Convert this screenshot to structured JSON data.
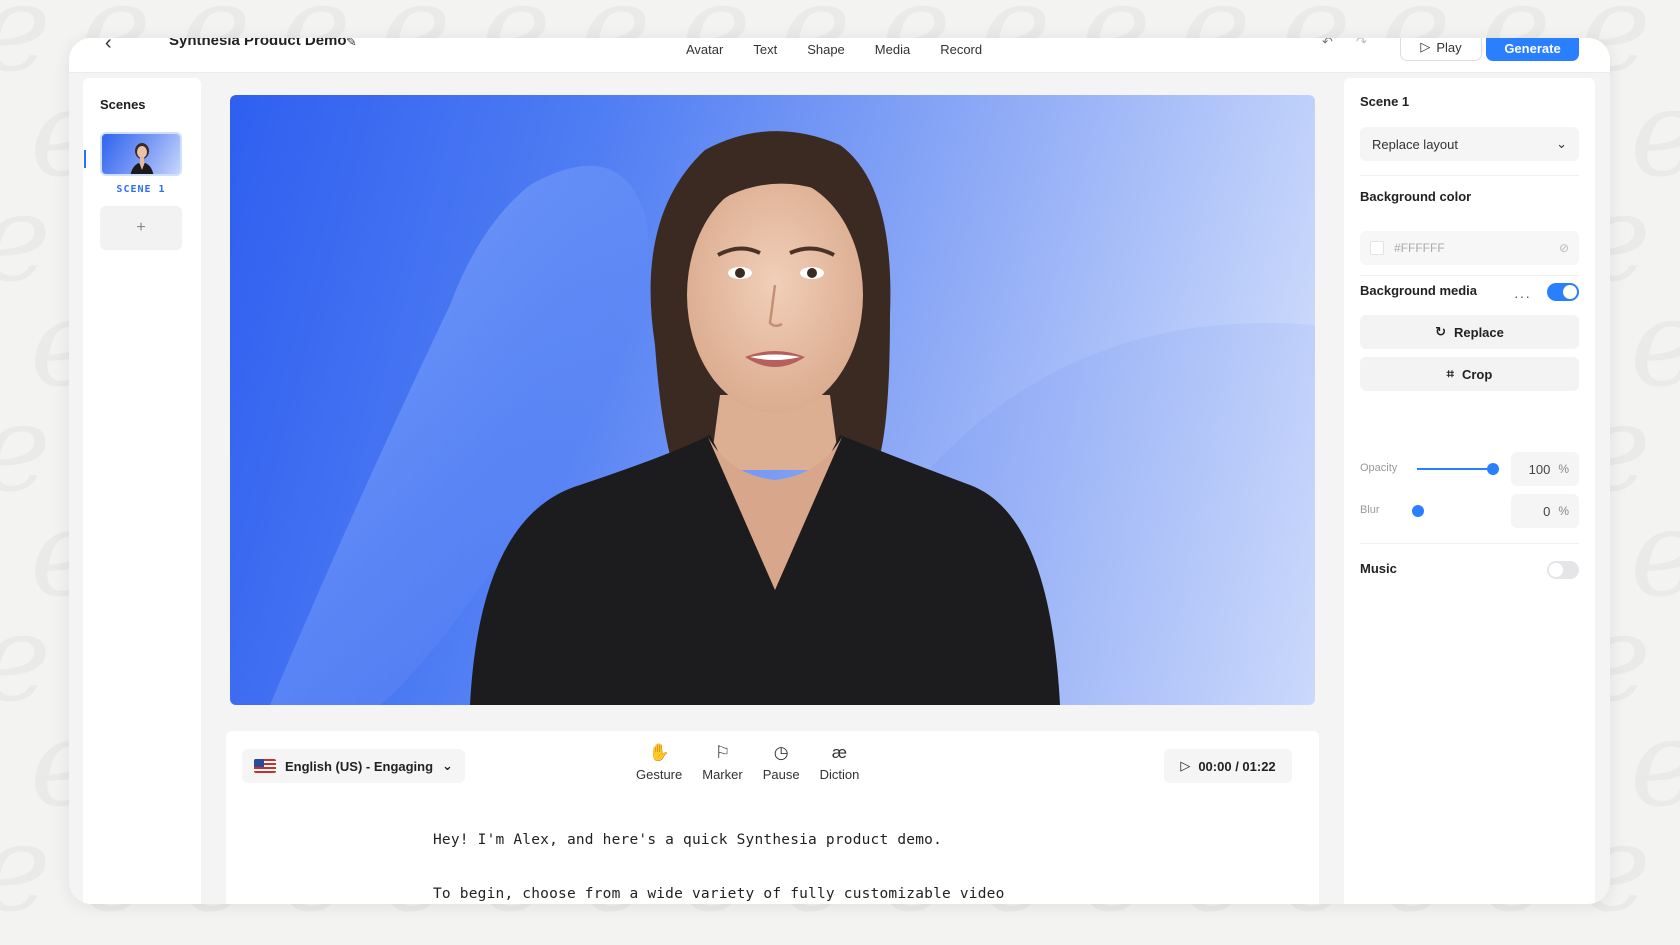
{
  "topbar": {
    "project_title": "Synthesia Product Demo",
    "tabs": [
      "Avatar",
      "Text",
      "Shape",
      "Media",
      "Record"
    ],
    "play_label": "Play",
    "generate_label": "Generate"
  },
  "scenes": {
    "title": "Scenes",
    "items": [
      {
        "label": "SCENE 1"
      }
    ],
    "add_label": "+"
  },
  "script": {
    "language": "English (US) - Engaging",
    "tools": [
      {
        "label": "Gesture",
        "icon": "hand-icon"
      },
      {
        "label": "Marker",
        "icon": "marker-icon"
      },
      {
        "label": "Pause",
        "icon": "clock-icon"
      },
      {
        "label": "Diction",
        "icon": "diction-icon"
      }
    ],
    "timer": "00:00 / 01:22",
    "lines": [
      "Hey! I'm Alex, and here's a quick Synthesia product demo.",
      "To begin, choose from a wide variety of fully customizable video"
    ]
  },
  "properties": {
    "scene_title": "Scene 1",
    "layout_select": "Replace layout",
    "background_color_label": "Background color",
    "background_color_value": "#FFFFFF",
    "background_media_label": "Background media",
    "background_media_enabled": true,
    "replace_label": "Replace",
    "crop_label": "Crop",
    "opacity_label": "Opacity",
    "opacity_value": "100",
    "blur_label": "Blur",
    "blur_value": "0",
    "percent_unit": "%",
    "music_label": "Music",
    "music_enabled": false
  },
  "colors": {
    "accent": "#2a7fff",
    "canvas_gradient_start": "#2f5ff0",
    "canvas_gradient_end": "#d9e4fc"
  }
}
